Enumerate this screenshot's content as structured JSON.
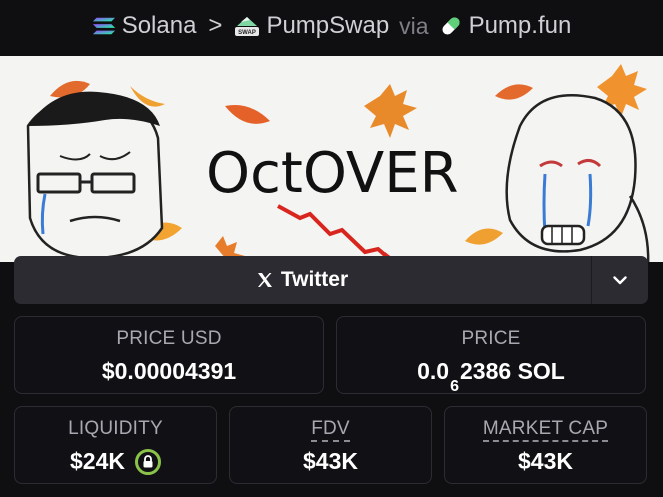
{
  "breadcrumb": {
    "chain": "Solana",
    "separator": ">",
    "dex": "PumpSwap",
    "dex_badge": "SWAP",
    "via": "via",
    "launchpad": "Pump.fun"
  },
  "banner": {
    "title": "OctOVER"
  },
  "social": {
    "twitter_label": "Twitter",
    "twitter_icon": "x-icon",
    "expand_icon": "chevron-down-icon"
  },
  "stats": {
    "price_usd": {
      "label": "PRICE USD",
      "value": "$0.00004391"
    },
    "price": {
      "label": "PRICE",
      "value_prefix": "0.0",
      "value_zeros": "6",
      "value_suffix": "2386 SOL"
    },
    "liquidity": {
      "label": "LIQUIDITY",
      "value": "$24K",
      "icon": "lock-icon"
    },
    "fdv": {
      "label": "FDV",
      "value": "$43K"
    },
    "market_cap": {
      "label": "MARKET CAP",
      "value": "$43K"
    }
  },
  "colors": {
    "background": "#0f0f12",
    "card_border": "#2c2c33",
    "lock_ring": "#8bc34a",
    "solana_gradient": [
      "#9945ff",
      "#19fb9b"
    ],
    "leaf_orange": "#e9822f",
    "arrow_red": "#d8261f"
  }
}
